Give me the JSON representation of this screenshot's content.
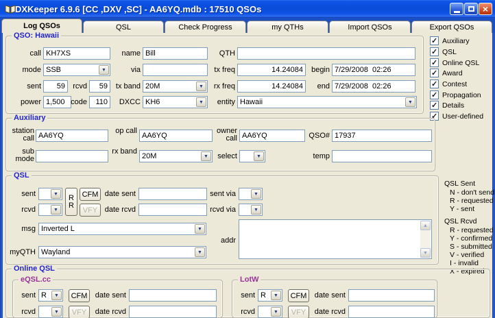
{
  "window": {
    "title": "DXKeeper 6.9.6 [CC ,DXV ,SC] - AA6YQ.mdb : 17510 QSOs",
    "close_glyph": "×"
  },
  "icons": {
    "dropdown_arrow": "▼",
    "scroll_up": "▲",
    "scroll_down": "▼"
  },
  "tabs": [
    {
      "label": "Log QSOs",
      "active": true
    },
    {
      "label": "QSL",
      "active": false
    },
    {
      "label": "Check Progress",
      "active": false
    },
    {
      "label": "my QTHs",
      "active": false
    },
    {
      "label": "Import QSOs",
      "active": false
    },
    {
      "label": "Export QSOs",
      "active": false
    }
  ],
  "qso": {
    "caption": "QSO: Hawaii",
    "call": {
      "label": "call",
      "value": "KH7XS"
    },
    "name": {
      "label": "name",
      "value": "Bill"
    },
    "qth": {
      "label": "QTH",
      "value": ""
    },
    "mode": {
      "label": "mode",
      "value": "SSB"
    },
    "via": {
      "label": "via",
      "value": ""
    },
    "tx_freq": {
      "label": "tx freq",
      "value": "14.24084"
    },
    "begin": {
      "label": "begin",
      "value": "7/29/2008  02:26"
    },
    "sent": {
      "label": "sent",
      "value": "59"
    },
    "rcvd": {
      "label": "rcvd",
      "value": "59"
    },
    "tx_band": {
      "label": "tx band",
      "value": "20M"
    },
    "rx_freq": {
      "label": "rx freq",
      "value": "14.24084"
    },
    "end": {
      "label": "end",
      "value": "7/29/2008  02:26"
    },
    "power": {
      "label": "power",
      "value": "1,500"
    },
    "code": {
      "label": "code",
      "value": "110"
    },
    "dxcc": {
      "label": "DXCC",
      "value": "KH6"
    },
    "entity": {
      "label": "entity",
      "value": "Hawaii"
    }
  },
  "display_checkboxes": [
    {
      "label": "Auxiliary",
      "checked": true
    },
    {
      "label": "QSL",
      "checked": true
    },
    {
      "label": "Online QSL",
      "checked": true
    },
    {
      "label": "Award",
      "checked": true
    },
    {
      "label": "Contest",
      "checked": true
    },
    {
      "label": "Propagation",
      "checked": true
    },
    {
      "label": "Details",
      "checked": true
    },
    {
      "label": "User-defined",
      "checked": true
    }
  ],
  "auxiliary": {
    "caption": "Auxiliary",
    "station_call": {
      "label": "station call",
      "value": "AA6YQ"
    },
    "op_call": {
      "label": "op call",
      "value": "AA6YQ"
    },
    "owner_call": {
      "label": "owner call",
      "value": "AA6YQ"
    },
    "qso_number": {
      "label": "QSO#",
      "value": "17937"
    },
    "sub_mode": {
      "label": "sub mode",
      "value": ""
    },
    "rx_band": {
      "label": "rx band",
      "value": "20M"
    },
    "select": {
      "label": "select",
      "value": ""
    },
    "temp": {
      "label": "temp",
      "value": ""
    }
  },
  "qsl": {
    "caption": "QSL",
    "sent": {
      "label": "sent",
      "value": ""
    },
    "rcvd": {
      "label": "rcvd",
      "value": ""
    },
    "rr_button": {
      "line1": "R",
      "line2": "R"
    },
    "cfm_button": "CFM",
    "vfy_button": "VFY",
    "date_sent": {
      "label": "date sent",
      "value": ""
    },
    "date_rcvd": {
      "label": "date rcvd",
      "value": ""
    },
    "sent_via": {
      "label": "sent via",
      "value": ""
    },
    "rcvd_via": {
      "label": "rcvd via",
      "value": ""
    },
    "msg": {
      "label": "msg",
      "value": "Inverted L"
    },
    "addr": {
      "label": "addr",
      "value": ""
    },
    "myqth": {
      "label": "myQTH",
      "value": "Wayland"
    }
  },
  "qsl_legend": {
    "sent_title": "QSL Sent",
    "sent_items": [
      "N - don't send",
      "R - requested",
      "Y - sent"
    ],
    "rcvd_title": "QSL Rcvd",
    "rcvd_items": [
      "R - requested",
      "Y - confirmed",
      "S - submitted",
      "V - verified",
      "I - invalid",
      "X - expired"
    ]
  },
  "online_qsl": {
    "caption": "Online QSL",
    "eqsl": {
      "caption": "eQSL.cc",
      "sent": {
        "label": "sent",
        "value": "R"
      },
      "rcvd": {
        "label": "rcvd",
        "value": ""
      },
      "cfm_button": "CFM",
      "vfy_button": "VFY",
      "date_sent": {
        "label": "date sent",
        "value": ""
      },
      "date_rcvd": {
        "label": "date rcvd",
        "value": ""
      }
    },
    "lotw": {
      "caption": "LotW",
      "sent": {
        "label": "sent",
        "value": "R"
      },
      "rcvd": {
        "label": "rcvd",
        "value": ""
      },
      "cfm_button": "CFM",
      "vfy_button": "VFY",
      "date_sent": {
        "label": "date sent",
        "value": ""
      },
      "date_rcvd": {
        "label": "date rcvd",
        "value": ""
      }
    }
  },
  "colors": {
    "titlebar_blue": "#0d52e6",
    "background": "#ece9d8",
    "caption_blue": "#2424cc",
    "caption_purple": "#993399",
    "close_red": "#d6542c"
  }
}
